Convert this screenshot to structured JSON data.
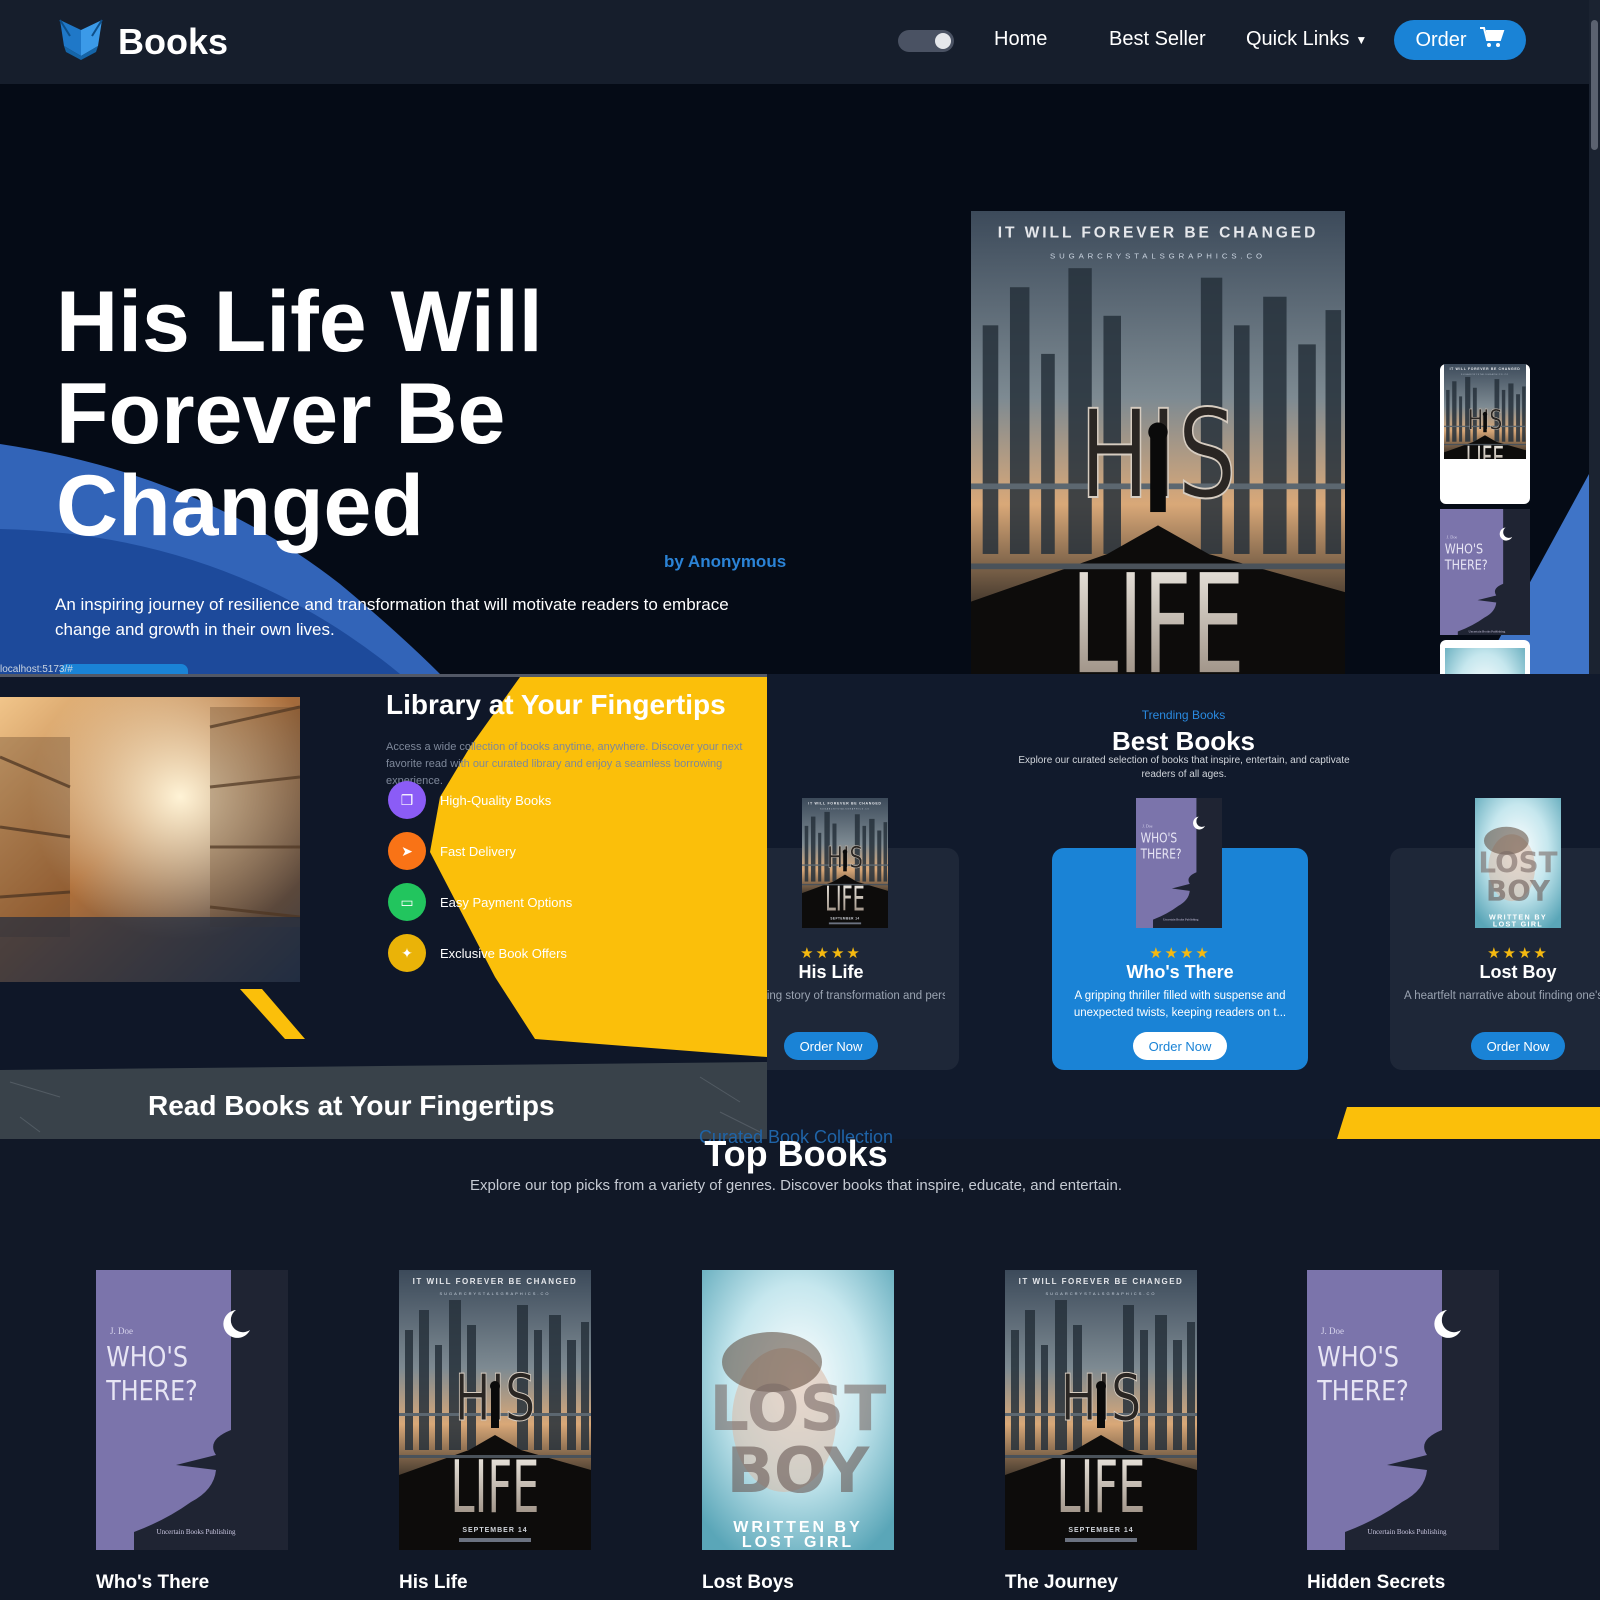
{
  "nav": {
    "brand": "Books",
    "links": [
      "Home",
      "Best Seller",
      "Quick Links"
    ],
    "order_label": "Order",
    "icons": [
      "book-logo-icon",
      "cart-icon",
      "caret-down-icon"
    ]
  },
  "hero": {
    "title": "His Life Will Forever Be Changed",
    "author": "by Anonymous",
    "description": "An inspiring journey of resilience and transformation that will motivate readers to embrace change and growth in their own lives.",
    "cover": {
      "tagline": "IT WILL FOREVER BE CHANGED",
      "credit": "SUGARCRYSTALSGRAPHICS",
      "line1": "HIS",
      "line2": "LIFE"
    },
    "status_url": "localhost:5173/#"
  },
  "library": {
    "title": "Library at Your Fingertips",
    "description": "Access a wide collection of books anytime, anywhere. Discover your next favorite read with our curated library and enjoy a seamless borrowing experience.",
    "features": [
      {
        "label": "High-Quality Books",
        "color": "#8b5cf6",
        "icon": "book-icon"
      },
      {
        "label": "Fast Delivery",
        "color": "#f97316",
        "icon": "truck-icon"
      },
      {
        "label": "Easy Payment Options",
        "color": "#22c55e",
        "icon": "card-icon"
      },
      {
        "label": "Exclusive Book Offers",
        "color": "#eab308",
        "icon": "gift-icon"
      }
    ],
    "banner_text": "Read Books at Your Fingertips"
  },
  "best": {
    "subtitle": "Trending Books",
    "title": "Best Books",
    "description": "Explore our curated selection of books that inspire, entertain, and captivate readers of all ages.",
    "cards": [
      {
        "title": "His Life",
        "stars": "★★★★",
        "desc": "A compelling story of transformation and personal growth that inspires readers to...",
        "button": "Order Now"
      },
      {
        "title": "Who's There",
        "stars": "★★★★",
        "desc": "A gripping thriller filled with suspense and unexpected twists, keeping readers on t...",
        "button": "Order Now"
      },
      {
        "title": "Lost Boy",
        "stars": "★★★★",
        "desc": "A heartfelt narrative about finding one's place in the world, exploring family, identity...",
        "button": "Order Now"
      }
    ]
  },
  "top": {
    "subtitle": "Curated Book Collection",
    "title": "Top Books",
    "description": "Explore our top picks from a variety of genres. Discover books that inspire, educate, and entertain.",
    "books": [
      {
        "name": "Who's There"
      },
      {
        "name": "His Life"
      },
      {
        "name": "Lost Boys"
      },
      {
        "name": "The Journey"
      },
      {
        "name": "Hidden Secrets"
      }
    ]
  },
  "covers": {
    "whos_there": {
      "author": "J. Doe",
      "line1": "WHO'S",
      "line2": "THERE?",
      "publisher": "Uncertain Books Publishing"
    },
    "his_life": {
      "tagline": "IT WILL FOREVER BE CHANGED",
      "credit": "SUGARCRYSTALSGRAPHICS.CO",
      "line1": "HIS",
      "line2": "LIFE",
      "date": "SEPTEMBER 14"
    },
    "lost_boy": {
      "line1": "LOST",
      "line2": "BOY",
      "byline1": "WRITTEN BY",
      "byline2": "LOST GIRL"
    }
  },
  "colors": {
    "accent_blue": "#1a83d6",
    "yellow": "#fbbf0a",
    "nav_bg": "#161e2c",
    "hero_bg": "#050b16",
    "star": "#f5b910"
  }
}
